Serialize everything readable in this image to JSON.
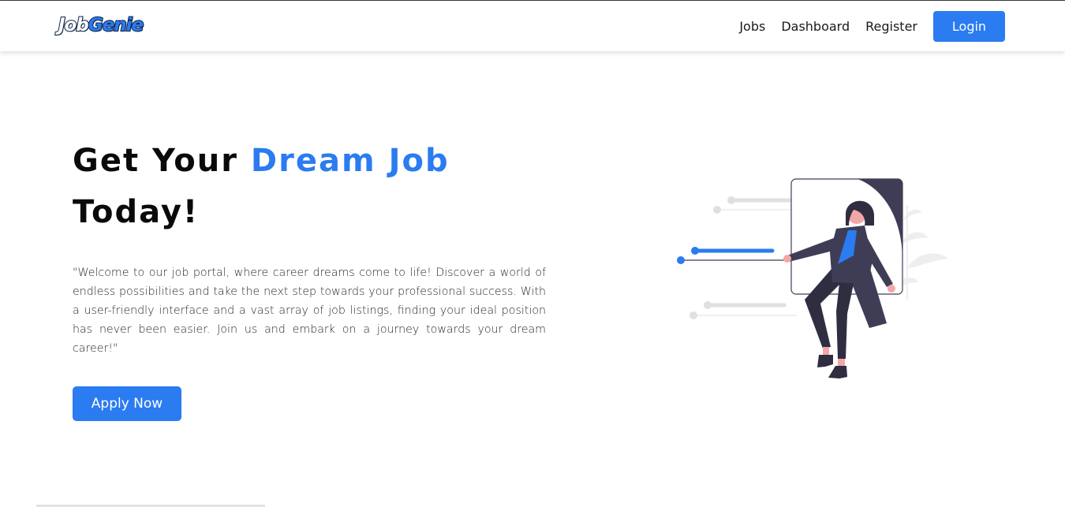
{
  "brand": {
    "part1": "Job",
    "part2": "Genie"
  },
  "nav": {
    "links": [
      "Jobs",
      "Dashboard",
      "Register"
    ],
    "login_label": "Login"
  },
  "hero": {
    "title_part1": "Get Your ",
    "title_accent": "Dream Job",
    "title_part2": "Today!",
    "description": "\"Welcome to our job portal, where career dreams come to life! Discover a world of endless possibilities and take the next step towards your professional success. With a user-friendly interface and a vast array of job listings, finding your ideal position has never been easier. Join us and embark on a journey towards your dream career!\"",
    "cta_label": "Apply Now"
  },
  "colors": {
    "accent": "#2b7bf1",
    "text_dark": "#0a0a0a",
    "navy": "#0d2447",
    "illustration_dark": "#3f3d56"
  },
  "icons": {
    "illustration": "woman-pulling-window-illustration"
  }
}
